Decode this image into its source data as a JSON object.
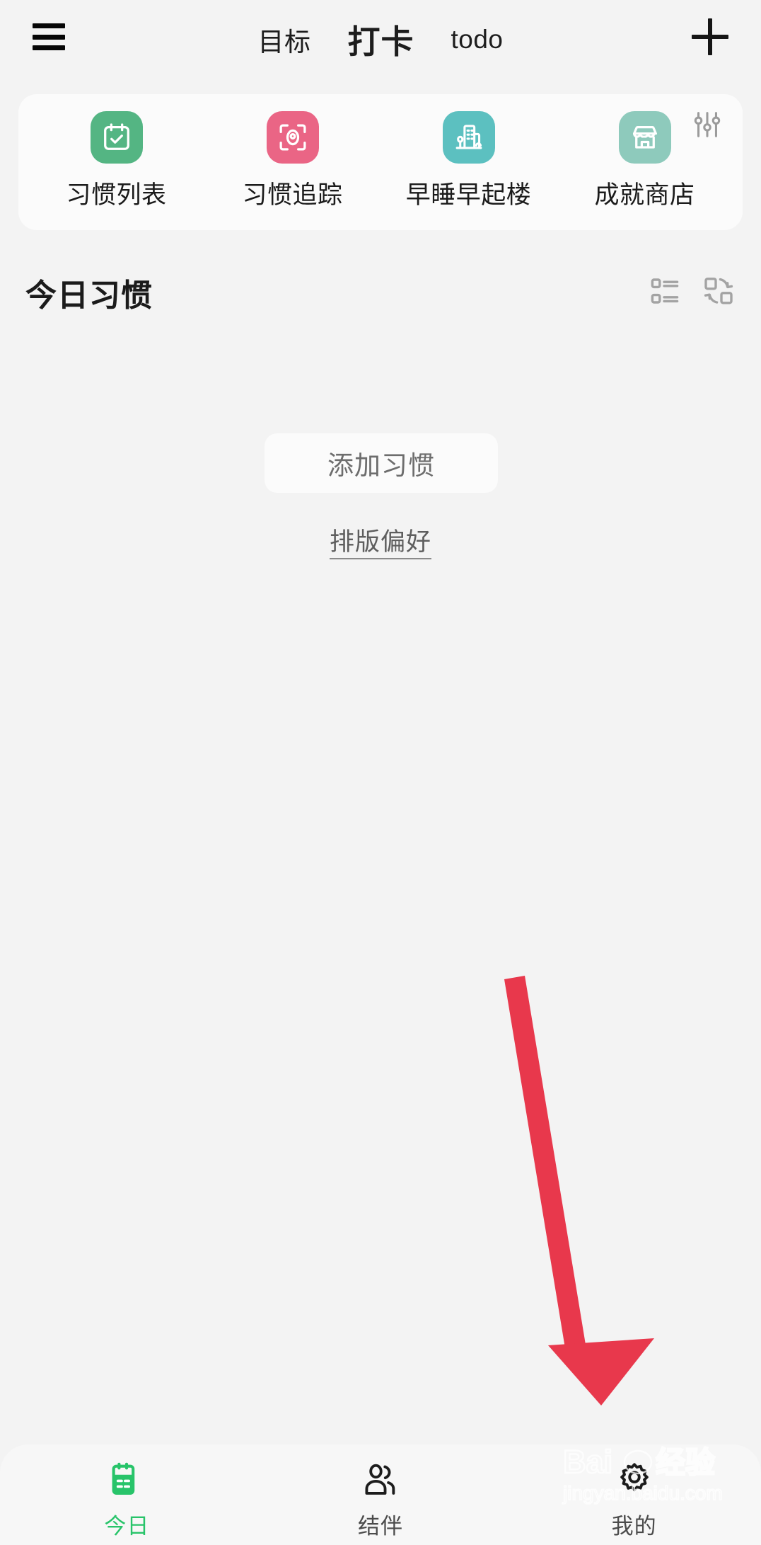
{
  "app": {
    "background_color": "#f3f3f3",
    "accent_green": "#28c46a"
  },
  "topbar": {
    "menu_icon": "hamburger-menu-icon",
    "add_icon": "plus-icon",
    "tabs": [
      {
        "label": "目标",
        "active": false
      },
      {
        "label": "打卡",
        "active": true
      },
      {
        "label": "todo",
        "active": false
      }
    ]
  },
  "shortcuts": {
    "settings_icon": "sliders-icon",
    "items": [
      {
        "label": "习惯列表",
        "icon": "calendar-check-icon",
        "color": "#54b583"
      },
      {
        "label": "习惯追踪",
        "icon": "target-focus-icon",
        "color": "#ea6585"
      },
      {
        "label": "早睡早起楼",
        "icon": "building-icon",
        "color": "#5cc0c0"
      },
      {
        "label": "成就商店",
        "icon": "store-icon",
        "color": "#8ecabc"
      }
    ]
  },
  "section": {
    "title": "今日习惯",
    "view_icons": [
      {
        "name": "list-view-icon"
      },
      {
        "name": "swap-view-icon"
      }
    ]
  },
  "empty_state": {
    "add_button_label": "添加习惯",
    "preference_link_label": "排版偏好"
  },
  "annotation": {
    "arrow_color": "#e8384c",
    "points_to": "我的"
  },
  "watermark": {
    "brand": "Baidu",
    "brand_cn": "经验",
    "url": "jingyan.baidu.com"
  },
  "bottom_nav": {
    "items": [
      {
        "label": "今日",
        "icon": "calendar-icon",
        "active": true
      },
      {
        "label": "结伴",
        "icon": "people-icon",
        "active": false
      },
      {
        "label": "我的",
        "icon": "gear-icon",
        "active": false
      }
    ]
  }
}
